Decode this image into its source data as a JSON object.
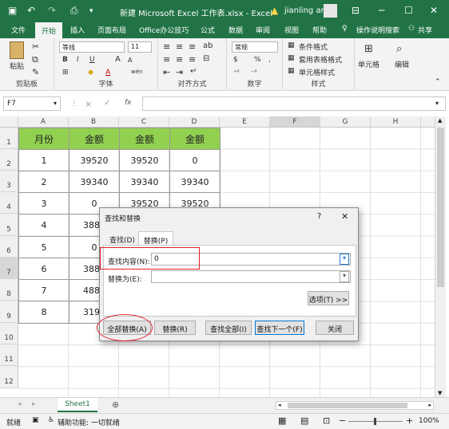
{
  "window": {
    "title": "新建 Microsoft Excel 工作表.xlsx  -  Excel",
    "user": "jianling an"
  },
  "ribbon_tabs": [
    "文件",
    "开始",
    "插入",
    "页面布局",
    "Office办公技巧",
    "公式",
    "数据",
    "审阅",
    "视图",
    "帮助",
    "操作说明搜索",
    "共享"
  ],
  "ribbon": {
    "clipboard": {
      "paste": "粘贴",
      "label": "剪贴板"
    },
    "font": {
      "name": "等线",
      "size": "11",
      "bold": "B",
      "italic": "I",
      "underline": "U",
      "grow": "A",
      "shrink": "A",
      "color": "A",
      "wen": "wén",
      "label": "字体"
    },
    "alignment": {
      "label": "对齐方式"
    },
    "number": {
      "format": "常规",
      "label": "数字",
      "percent": "%",
      "comma": ","
    },
    "styles": {
      "cond": "条件格式",
      "table": "套用表格格式",
      "cell": "单元格样式",
      "label": "样式"
    },
    "cells": {
      "label": "单元格"
    },
    "editing": {
      "label": "编辑"
    }
  },
  "formula_bar": {
    "name_box": "F7",
    "fx": "fx",
    "cancel": "×",
    "enter": "✓"
  },
  "sheet": {
    "columns": [
      "A",
      "B",
      "C",
      "D",
      "E",
      "F",
      "G",
      "H"
    ],
    "rows": [
      "1",
      "2",
      "3",
      "4",
      "5",
      "6",
      "7",
      "8",
      "9",
      "10",
      "11",
      "12"
    ],
    "header": [
      "月份",
      "金额",
      "金额",
      "金额"
    ],
    "data": [
      [
        "1",
        "39520",
        "39520",
        "0"
      ],
      [
        "2",
        "39340",
        "39340",
        "39340"
      ],
      [
        "3",
        "0",
        "39520",
        "39520"
      ],
      [
        "4",
        "3886",
        "",
        ""
      ],
      [
        "5",
        "0",
        "",
        ""
      ],
      [
        "6",
        "3886",
        "",
        ""
      ],
      [
        "7",
        "4886",
        "",
        ""
      ],
      [
        "8",
        "3196",
        "",
        ""
      ]
    ],
    "tab": "Sheet1"
  },
  "status": {
    "ready": "就绪",
    "accessibility": "辅助功能: 一切就绪",
    "zoom": "100%"
  },
  "dialog": {
    "title": "查找和替换",
    "help": "?",
    "close": "✕",
    "tabs": [
      "查找(D)",
      "替换(P)"
    ],
    "find_label": "查找内容(N):",
    "find_value": "0",
    "replace_label": "替换为(E):",
    "replace_value": "",
    "options": "选项(T) >>",
    "buttons": [
      "全部替换(A)",
      "替换(R)",
      "查找全部(I)",
      "查找下一个(F)",
      "关闭"
    ]
  },
  "colors": {
    "excel_green": "#217346",
    "header_fill": "#92d050",
    "highlight": "#e0202a"
  }
}
